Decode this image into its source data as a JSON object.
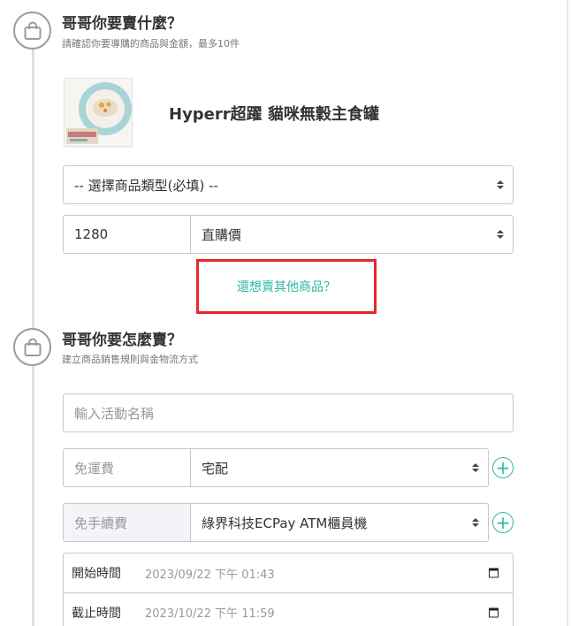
{
  "step1": {
    "title": "哥哥你要賣什麼？",
    "subtitle": "請確認你要導購的商品與金額，最多10件",
    "icon": "shopping-bag-icon"
  },
  "product": {
    "name": "Hyperr超躍 貓咪無穀主食罐",
    "image": "cat-food-can-photo"
  },
  "product_type_select": {
    "value": "-- 選擇商品類型(必填) --"
  },
  "price_row": {
    "price_value": "1280",
    "price_type": "直購價"
  },
  "more_products_link": "還想賣其他商品？",
  "step2": {
    "title": "哥哥你要怎麼賣？",
    "subtitle": "建立商品銷售規則與金物流方式",
    "icon": "shopping-bag-icon"
  },
  "campaign_name": {
    "placeholder": "輸入活動名稱"
  },
  "shipping": {
    "fee_placeholder": "免運費",
    "method": "宅配"
  },
  "payment": {
    "fee_placeholder": "免手續費",
    "method": "綠界科技ECPay ATM櫃員機"
  },
  "dates": {
    "start_label": "開始時間",
    "start_value": "2023/09/22 下午 01:43",
    "end_label": "截止時間",
    "end_value": "2023/10/22 下午 11:59"
  },
  "colors": {
    "accent": "#2eb8a2",
    "highlight_border": "#e8272b",
    "timeline": "#9b9b9b"
  }
}
